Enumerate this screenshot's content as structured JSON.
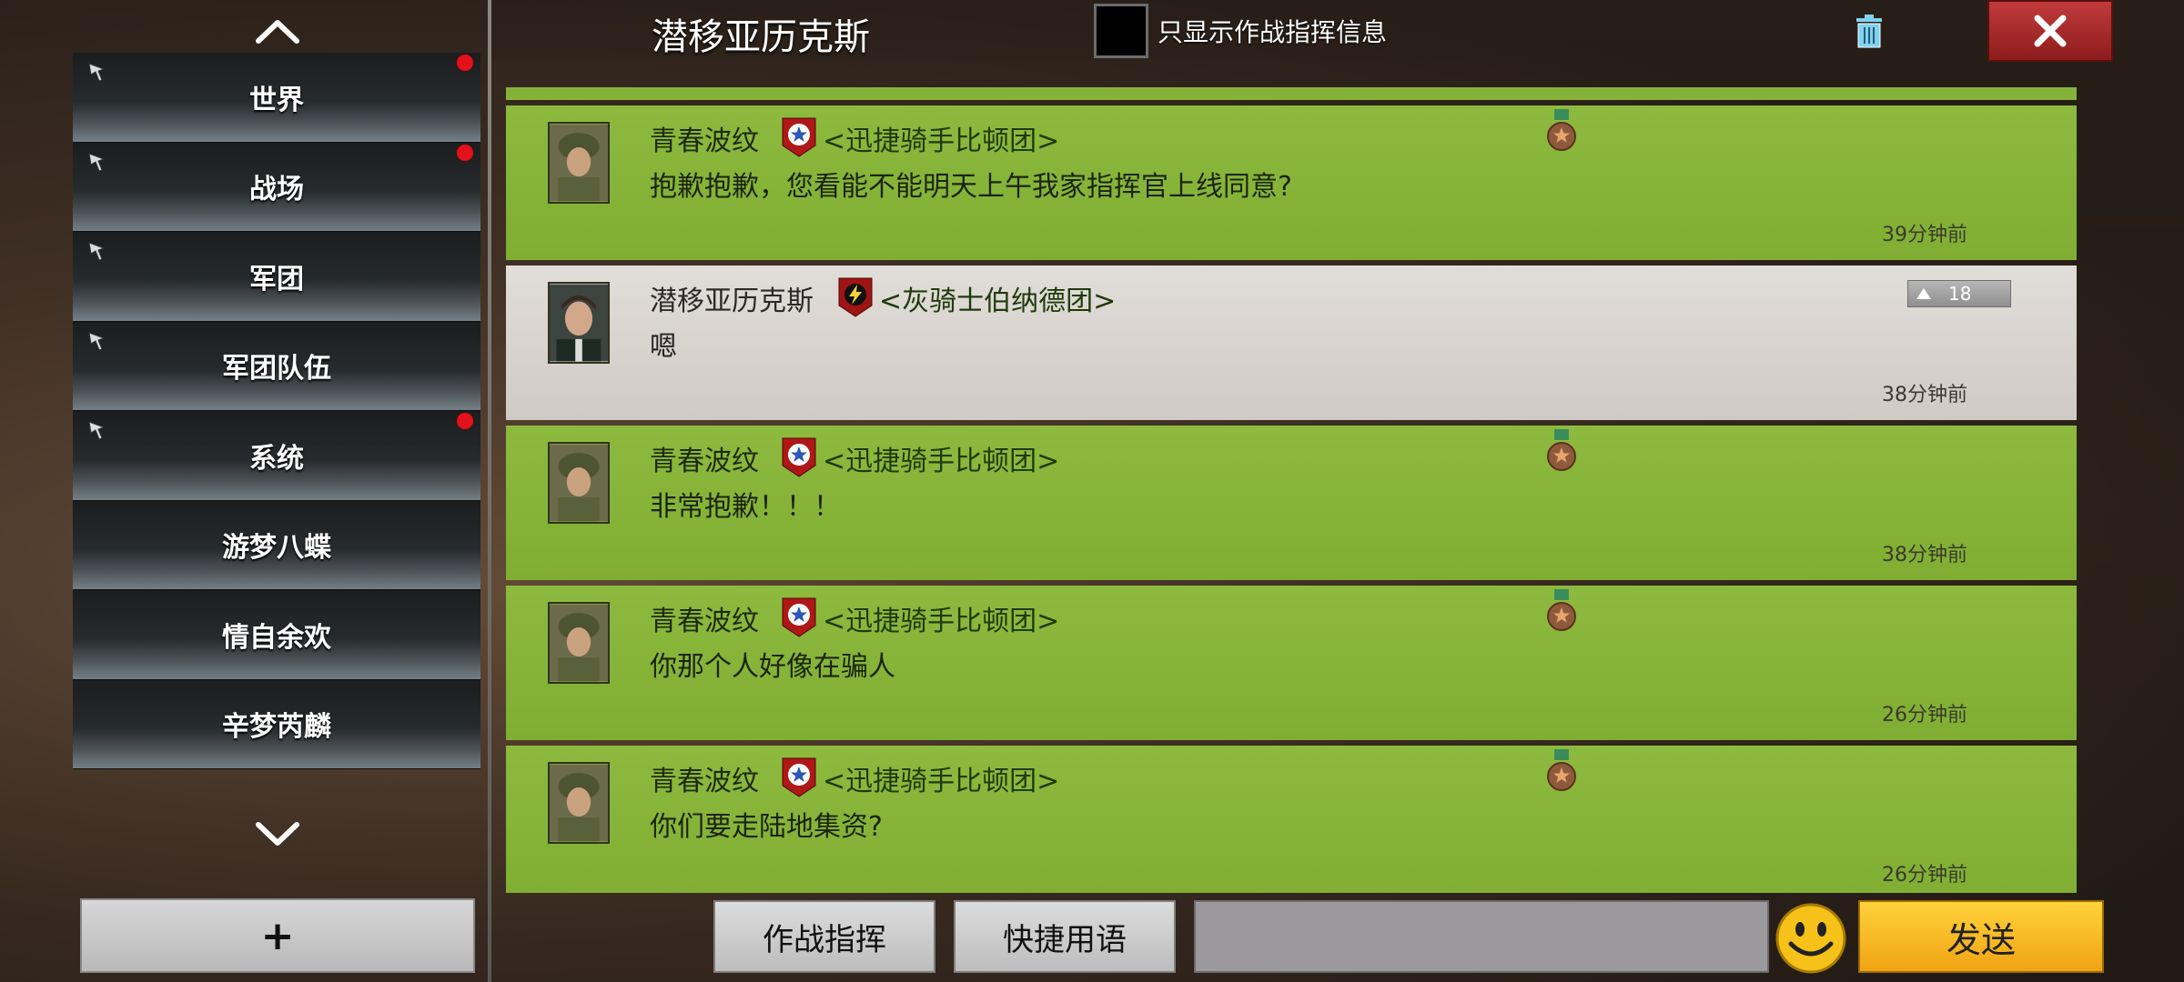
{
  "window": {
    "title": "潜移亚历克斯",
    "cmd_filter_label": "只显示作战指挥信息"
  },
  "channels": [
    {
      "label": "世界",
      "pinned": true,
      "unread": true
    },
    {
      "label": "战场",
      "pinned": true,
      "unread": true
    },
    {
      "label": "军团",
      "pinned": true,
      "unread": false
    },
    {
      "label": "军团队伍",
      "pinned": true,
      "unread": false
    },
    {
      "label": "系统",
      "pinned": true,
      "unread": true
    },
    {
      "label": "游梦八蝶",
      "pinned": false,
      "unread": false
    },
    {
      "label": "情自余欢",
      "pinned": false,
      "unread": false
    },
    {
      "label": "辛梦芮麟",
      "pinned": false,
      "unread": false
    }
  ],
  "add_button_label": "+",
  "messages": [
    {
      "sender": "青春波纹",
      "legion": "<迅捷骑手比顿团>",
      "text": "抱歉抱歉，您看能不能明天上午我家指挥官上线同意?",
      "time": "39分钟前",
      "style": "green"
    },
    {
      "sender": "潜移亚历克斯",
      "legion": "<灰骑士伯纳德团>",
      "text": "嗯",
      "time": "38分钟前",
      "style": "grey",
      "rank": "18"
    },
    {
      "sender": "青春波纹",
      "legion": "<迅捷骑手比顿团>",
      "text": "非常抱歉！！！",
      "time": "38分钟前",
      "style": "green"
    },
    {
      "sender": "青春波纹",
      "legion": "<迅捷骑手比顿团>",
      "text": "你那个人好像在骗人",
      "time": "26分钟前",
      "style": "green"
    },
    {
      "sender": "青春波纹",
      "legion": "<迅捷骑手比顿团>",
      "text": "你们要走陆地集资?",
      "time": "26分钟前",
      "style": "green"
    }
  ],
  "bottom": {
    "combat_cmd_label": "作战指挥",
    "quick_phrase_label": "快捷用语",
    "input_value": "",
    "send_label": "发送"
  }
}
